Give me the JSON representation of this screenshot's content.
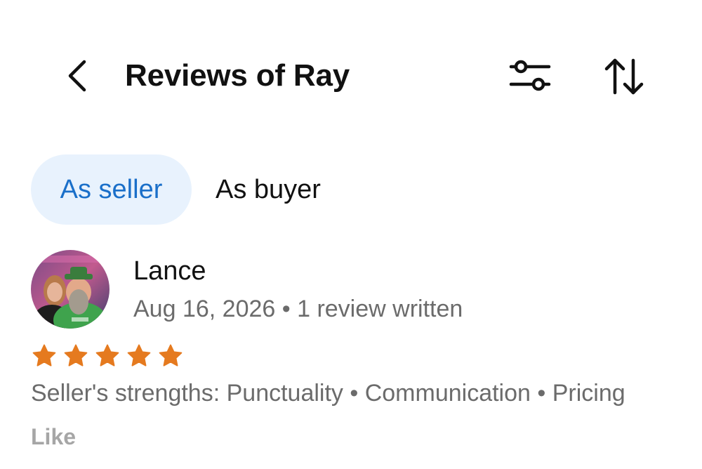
{
  "header": {
    "title": "Reviews of Ray",
    "back_icon": "chevron-left-icon",
    "filter_icon": "sliders-icon",
    "sort_icon": "sort-arrows-icon"
  },
  "tabs": [
    {
      "label": "As seller",
      "selected": true
    },
    {
      "label": "As buyer",
      "selected": false
    }
  ],
  "review": {
    "reviewer_name": "Lance",
    "meta": "Aug 16, 2026 • 1 review written",
    "rating": 5,
    "rating_max": 5,
    "strengths": "Seller's strengths: Punctuality • Communication • Pricing",
    "like_label": "Like"
  },
  "colors": {
    "accent": "#1a6fc9",
    "tab_selected_bg": "#e8f2fd",
    "star": "#e57a1f",
    "secondary_text": "#6b6b6b",
    "muted_text": "#a6a6a6"
  }
}
